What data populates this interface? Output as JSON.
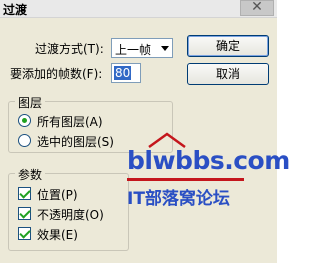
{
  "window": {
    "title": "过渡",
    "close_glyph": "✕"
  },
  "method": {
    "label": "过渡方式(T):",
    "value": "上一帧"
  },
  "frames": {
    "label": "要添加的帧数(F):",
    "value": "80"
  },
  "buttons": {
    "ok": "确定",
    "cancel": "取消"
  },
  "layers": {
    "title": "图层",
    "options": [
      {
        "label": "所有图层(A)",
        "checked": true
      },
      {
        "label": "选中的图层(S)",
        "checked": false
      }
    ]
  },
  "params": {
    "title": "参数",
    "options": [
      {
        "label": "位置(P)",
        "checked": true
      },
      {
        "label": "不透明度(O)",
        "checked": true
      },
      {
        "label": "效果(E)",
        "checked": true
      }
    ]
  },
  "watermark": {
    "site": "blwbbs.com",
    "name": "IT部落窝论坛"
  },
  "colors": {
    "accent": "#2a4fc4",
    "watermark_line": "#c4161c",
    "check": "#21a121",
    "selection": "#3169c6"
  }
}
